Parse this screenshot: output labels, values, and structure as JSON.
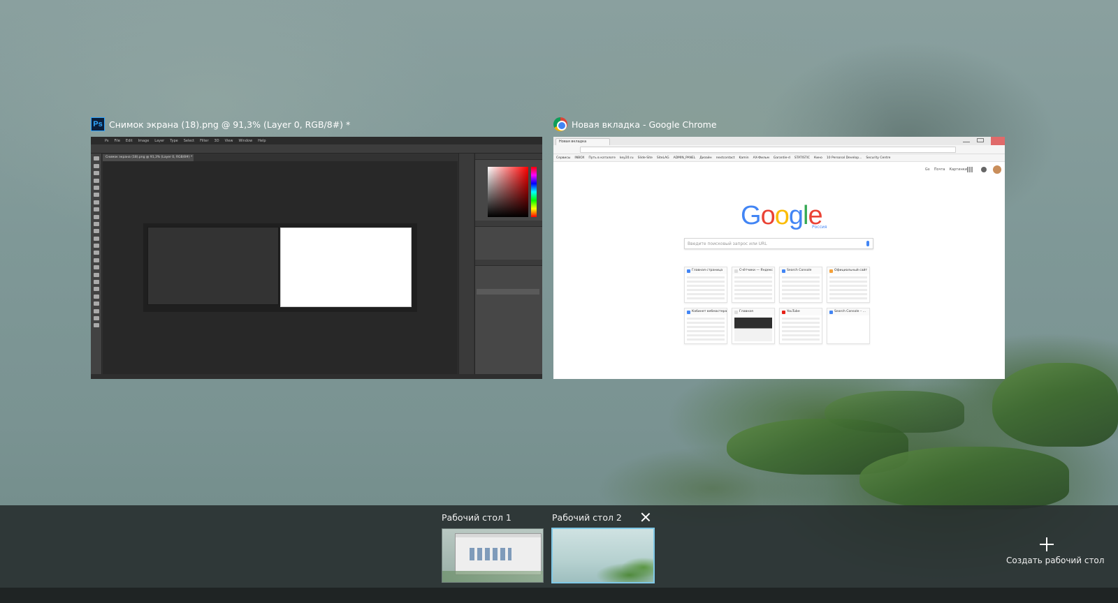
{
  "windows": {
    "photoshop": {
      "title": "Снимок экрана (18).png @ 91,3% (Layer 0, RGB/8#) *",
      "app_icon_letters": "Ps",
      "icon": "photoshop-icon",
      "menu": [
        "Ps",
        "File",
        "Edit",
        "Image",
        "Layer",
        "Type",
        "Select",
        "Filter",
        "3D",
        "View",
        "Window",
        "Help"
      ],
      "doc_tab": "Снимок экрана (18).png @ 91,3% (Layer 0, RGB/8#) *"
    },
    "chrome": {
      "title": "Новая вкладка - Google Chrome",
      "icon": "chrome-icon",
      "tab_label": "Новая вкладка",
      "bookmarks": [
        "Сервисы",
        "INBOX",
        "Путь в каталоге",
        "key20.ru",
        "Slide-Site",
        "SiteLAG",
        "ADMIN_PANEL",
        "Дизайн",
        "nextcontact",
        "Kamin",
        "AX-Фильм",
        "Garantie-d",
        "STATISTIC",
        "Кино",
        "10 Personal Develop...",
        "Security Centre"
      ],
      "top_links": [
        "Gx",
        "Почта",
        "Картинки"
      ],
      "logo": {
        "G": "G",
        "o1": "o",
        "o2": "o",
        "g": "g",
        "l": "l",
        "e": "e"
      },
      "region": "Россия",
      "search_placeholder": "Введите поисковый запрос или URL",
      "tiles": [
        {
          "title": "Главная страница",
          "fav": "#4285f4",
          "preview": "light"
        },
        {
          "title": "Счётчики — Яндекс",
          "fav": "#dddddd",
          "preview": "light"
        },
        {
          "title": "Search Console",
          "fav": "#4285f4",
          "preview": "light"
        },
        {
          "title": "Официальный сайт",
          "fav": "#f4a13a",
          "preview": "light"
        },
        {
          "title": "Кабинет вебмастера",
          "fav": "#4285f4",
          "preview": "light"
        },
        {
          "title": "Главная",
          "fav": "#dddddd",
          "preview": "dark"
        },
        {
          "title": "YouTube",
          "fav": "#e62117",
          "preview": "light"
        },
        {
          "title": "Search Console – ...",
          "fav": "#4285f4",
          "preview": "blank"
        }
      ]
    }
  },
  "desktops": {
    "items": [
      {
        "label": "Рабочий стол 1",
        "active": false
      },
      {
        "label": "Рабочий стол 2",
        "active": true
      }
    ],
    "create_label": "Создать рабочий стол"
  },
  "colors": {
    "strip_bg": "#262c2c",
    "active_border": "#7fc8e6",
    "ps_accent": "#31a8ff"
  }
}
